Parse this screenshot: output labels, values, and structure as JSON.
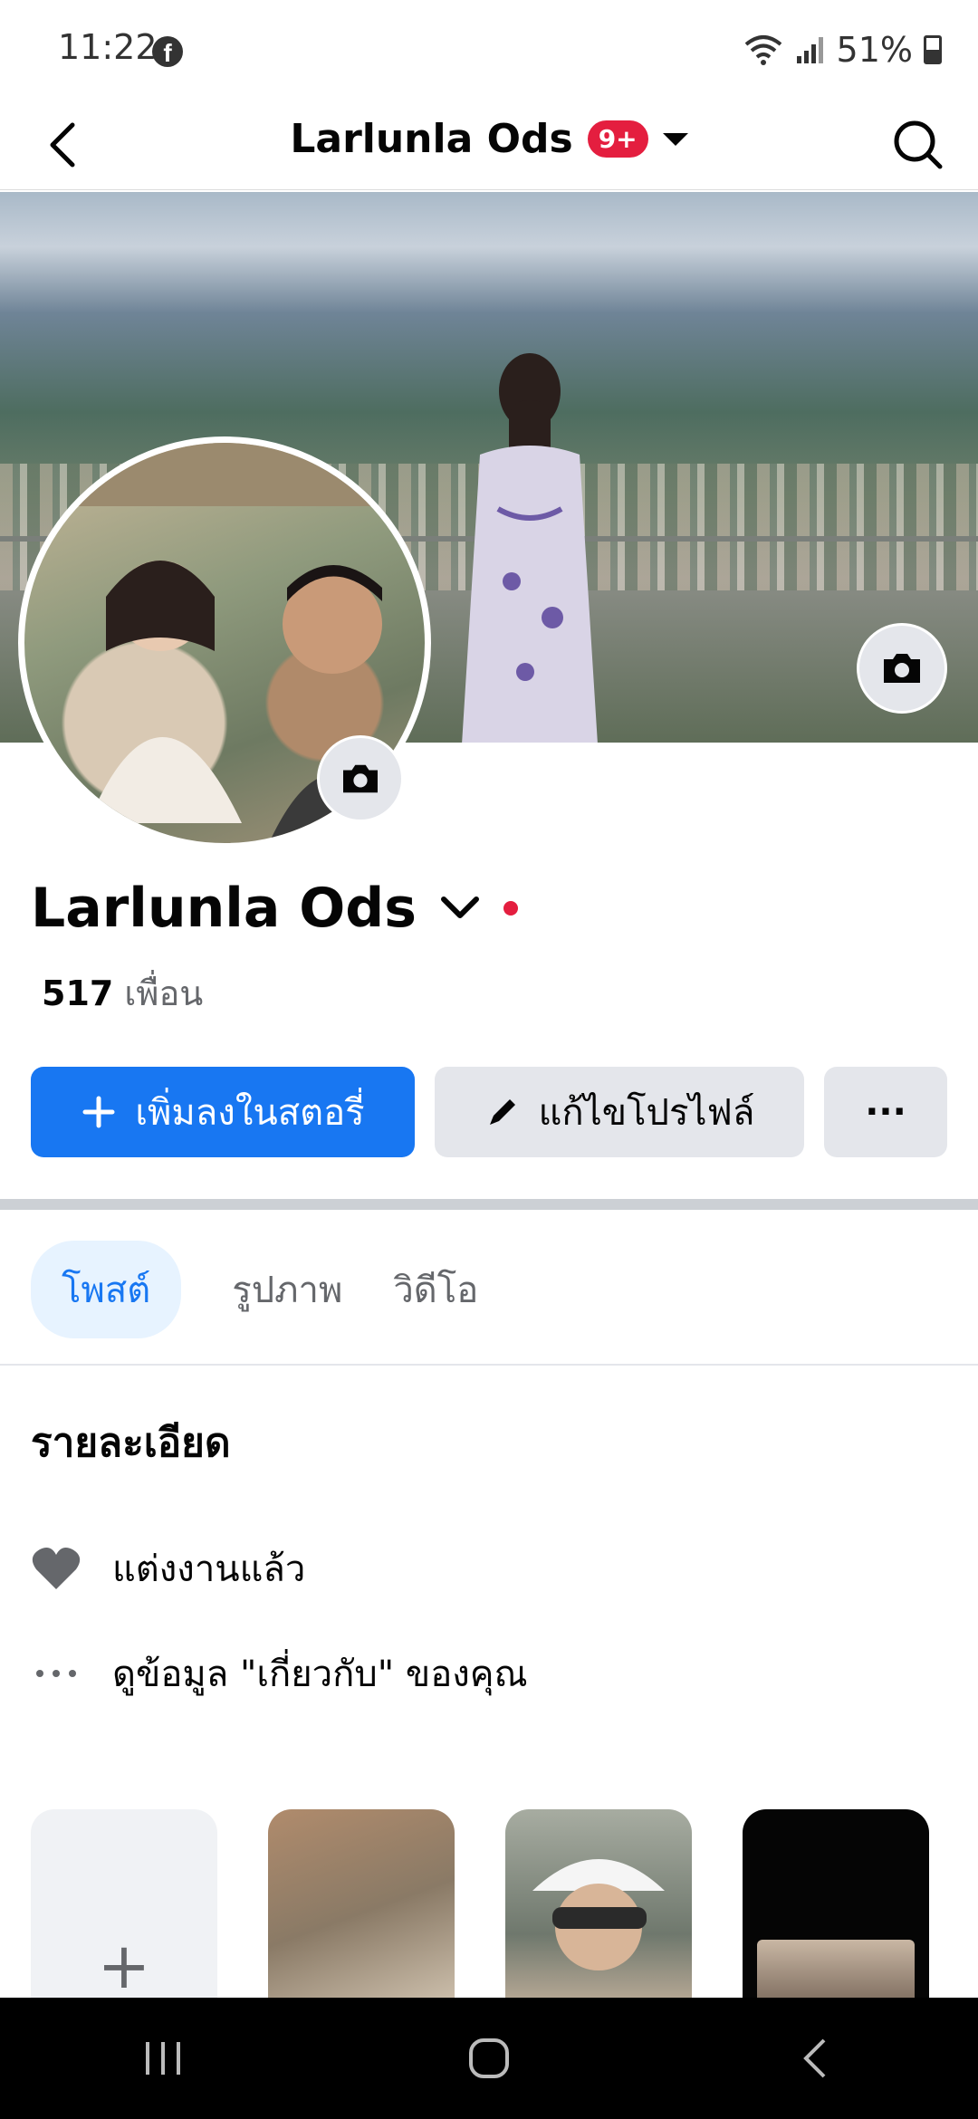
{
  "status_bar": {
    "time": "11:22",
    "battery": "51%",
    "app_icon": "facebook-icon",
    "icons": [
      "wifi-icon",
      "signal-icon",
      "battery-icon"
    ]
  },
  "nav": {
    "title": "Larlunla Ods",
    "badge": "9+",
    "back_icon": "back-arrow-icon",
    "search_icon": "search-icon"
  },
  "profile": {
    "name": "Larlunla Ods",
    "friends_count": "517",
    "friends_label": "เพื่อน"
  },
  "actions": {
    "add_story": "เพิ่มลงในสตอรี่",
    "edit_profile": "แก้ไขโปรไฟล์",
    "more": "···"
  },
  "tabs": [
    {
      "label": "โพสต์",
      "active": true
    },
    {
      "label": "รูปภาพ",
      "active": false
    },
    {
      "label": "วิดีโอ",
      "active": false
    }
  ],
  "details": {
    "title": "รายละเอียด",
    "items": [
      {
        "icon": "heart-icon",
        "text": "แต่งงานแล้ว"
      },
      {
        "icon": "more-dots-icon",
        "text": "ดูข้อมูล \"เกี่ยวกับ\" ของคุณ"
      }
    ]
  },
  "stories": {
    "add_symbol": "+"
  },
  "colors": {
    "primary": "#1877f2",
    "secondary_bg": "#e4e6eb",
    "badge": "#e41e3f",
    "text": "#050505",
    "muted": "#65676b"
  }
}
